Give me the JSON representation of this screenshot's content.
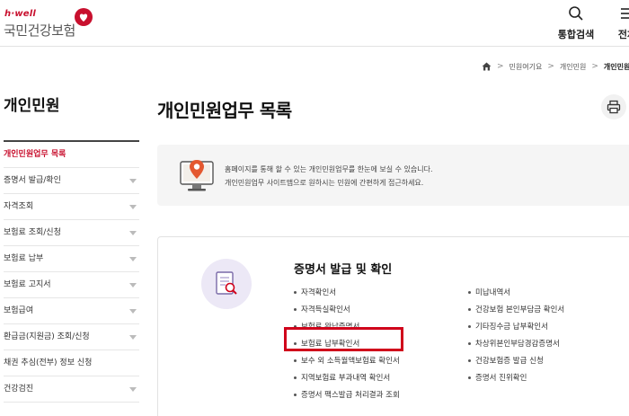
{
  "header": {
    "logo_small": "h·well",
    "logo_main": "국민건강보험",
    "search_label": "통합검색",
    "menu_label": "전체"
  },
  "breadcrumb": {
    "items": [
      "민원여기요",
      "개인민원",
      "개인민원"
    ]
  },
  "sidebar": {
    "title": "개인민원",
    "items": [
      {
        "label": "개인민원업무 목록",
        "active": true
      },
      {
        "label": "증명서 발급/확인"
      },
      {
        "label": "자격조회"
      },
      {
        "label": "보험료 조회/신청"
      },
      {
        "label": "보험료 납부"
      },
      {
        "label": "보험료 고지서"
      },
      {
        "label": "보험급여"
      },
      {
        "label": "환급금(지원금) 조회/신청"
      },
      {
        "label": "채권 추심(전부) 정보 신청"
      },
      {
        "label": "건강검진"
      }
    ]
  },
  "main": {
    "title": "개인민원업무 목록",
    "info_line1": "홈페이지를 통해 할 수 있는 개인민원업무를 한눈에 보실 수 있습니다.",
    "info_line2": "개인민원업무 사이트맵으로 원하시는 민원에 간편하게 접근하세요.",
    "section_title": "증명서 발급 및 확인",
    "col1": [
      "자격확인서",
      "자격득실확인서",
      "보험료 완납증명서",
      "보험료 납부확인서",
      "보수 외 소득월액보험료 확인서",
      "지역보험료 부과내역 확인서",
      "증명서 팩스발급 처리결과 조회"
    ],
    "col2": [
      "미납내역서",
      "건강보험 본인부담금 확인서",
      "기타징수금 납부확인서",
      "차상위본인부담경감증명서",
      "건강보험증 발급 신청",
      "증명서 진위확인"
    ]
  },
  "colors": {
    "brand_red": "#c8102e",
    "highlight_red": "#d0021b"
  }
}
